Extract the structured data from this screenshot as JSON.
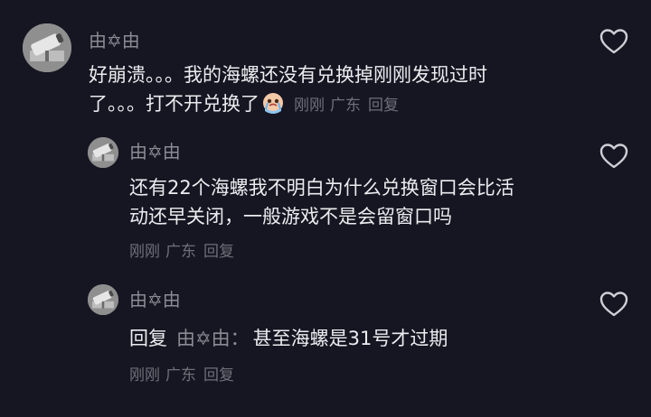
{
  "comments": [
    {
      "username": "由✡由",
      "text_line1": "好崩溃。。。我的海螺还没有兑换掉刚刚发现过时",
      "text_line2": "了。。。打不开兑换了",
      "emoji": "crying-face-emoji",
      "time": "刚刚",
      "location": "广东",
      "reply_label": "回复"
    },
    {
      "username": "由✡由",
      "text_line1": "还有22个海螺我不明白为什么兑换窗口会比活",
      "text_line2": "动还早关闭，一般游戏不是会留窗口吗",
      "time": "刚刚",
      "location": "广东",
      "reply_label": "回复"
    },
    {
      "username": "由✡由",
      "reply_prefix": "回复",
      "reply_to": "由✡由：",
      "text": "甚至海螺是31号才过期",
      "time": "刚刚",
      "location": "广东",
      "reply_label": "回复"
    }
  ],
  "icons": {
    "like": "heart-outline-icon",
    "avatar": "security-camera-avatar"
  },
  "colors": {
    "background": "#161622",
    "text": "#ececf0",
    "username": "#8b8b95",
    "meta": "#6f6f7a"
  }
}
